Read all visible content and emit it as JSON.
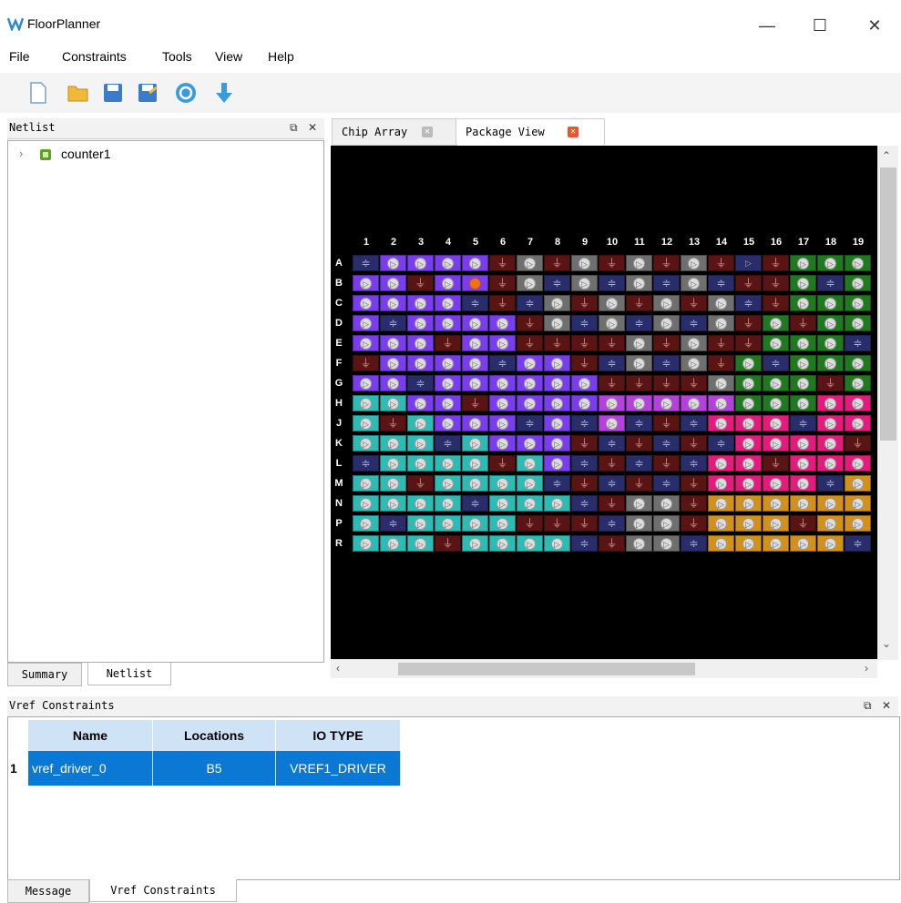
{
  "app": {
    "title": "FloorPlanner",
    "window_buttons": {
      "minimize": "—",
      "maximize": "☐",
      "close": "✕"
    }
  },
  "menu": [
    "File",
    "Constraints",
    "Tools",
    "View",
    "Help"
  ],
  "toolbar": {
    "buttons": [
      "new-file-icon",
      "open-folder-icon",
      "save-icon",
      "save-as-icon",
      "refresh-icon",
      "download-arrow-icon"
    ]
  },
  "netlist": {
    "title": "Netlist",
    "tree_item": "counter1",
    "tabs": [
      "Summary",
      "Netlist"
    ]
  },
  "editor_tabs": [
    {
      "label": "Chip Array",
      "active": false
    },
    {
      "label": "Package View",
      "active": true
    }
  ],
  "package": {
    "columns": [
      "1",
      "2",
      "3",
      "4",
      "5",
      "6",
      "7",
      "8",
      "9",
      "10",
      "11",
      "12",
      "13",
      "14",
      "15",
      "16",
      "17",
      "18",
      "19"
    ],
    "rows": [
      "A",
      "B",
      "C",
      "D",
      "E",
      "F",
      "G",
      "H",
      "J",
      "K",
      "L",
      "M",
      "N",
      "P",
      "R"
    ],
    "bank_colors": {
      "purple": "#7b3cf0",
      "teal": "#2bbcb6",
      "maroon": "#5a1414",
      "navy": "#2a2d6b",
      "gray": "#6f6f6f",
      "green": "#1f7a1f",
      "magenta": "#e6197f",
      "orange": "#d4911a",
      "violet": "#b63fe0"
    }
  },
  "vref": {
    "title": "Vref Constraints",
    "columns": [
      "Name",
      "Locations",
      "IO TYPE"
    ],
    "rows": [
      {
        "index": "1",
        "name": "vref_driver_0",
        "location": "B5",
        "io_type": "VREF1_DRIVER"
      }
    ]
  },
  "bottom_tabs": [
    "Message",
    "Vref Constraints"
  ]
}
